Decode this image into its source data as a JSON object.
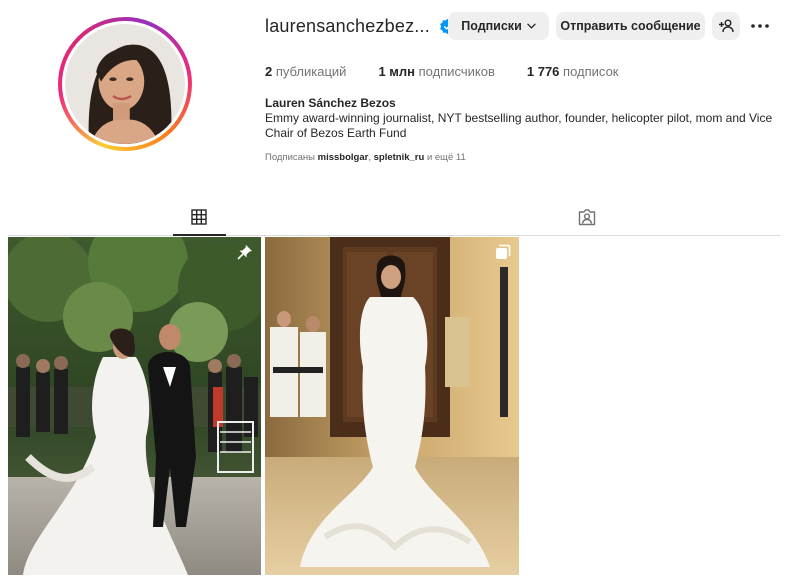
{
  "profile": {
    "username": "laurensanchezbez...",
    "verified": true,
    "full_name": "Lauren Sánchez Bezos",
    "bio": "Emmy award-winning journalist, NYT bestselling author, founder, helicopter pilot, mom and Vice Chair of Bezos Earth Fund"
  },
  "actions": {
    "follow_label": "Подписки",
    "message_label": "Отправить сообщение"
  },
  "stats": {
    "posts_count": "2",
    "posts_label": "публикаций",
    "followers_count": "1 млн",
    "followers_label": "подписчиков",
    "following_count": "1 776",
    "following_label": "подписок"
  },
  "followed_by": {
    "prefix": "Подписаны",
    "user1": "missbolgar",
    "separator": ",",
    "user2": "spletnik_ru",
    "suffix": "и ещё 11"
  },
  "tabs": [
    {
      "icon": "grid-icon",
      "active": true
    },
    {
      "icon": "tagged-icon",
      "active": false
    }
  ],
  "posts": [
    {
      "badge_icon": "pin-icon"
    },
    {
      "badge_icon": "carousel-icon"
    }
  ],
  "colors": {
    "verified_blue": "#0095f6",
    "button_bg": "#efefef",
    "secondary_text": "#737373"
  }
}
